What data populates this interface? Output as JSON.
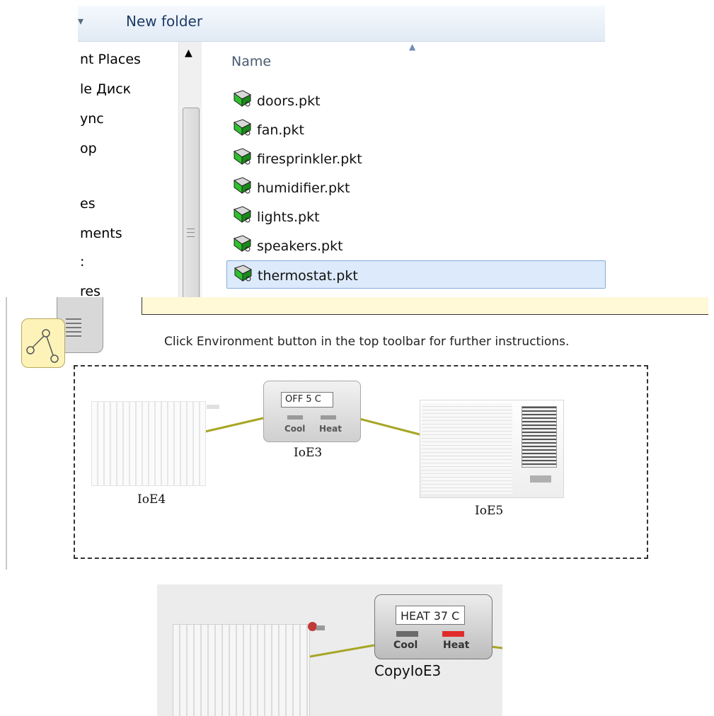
{
  "explorer": {
    "toolbar": {
      "new_folder_label": "New folder"
    },
    "nav_items": [
      {
        "label": "nt Places"
      },
      {
        "label": "le Диск"
      },
      {
        "label": "ync"
      },
      {
        "label": "op"
      },
      {
        "label": "es"
      },
      {
        "label": "ments"
      },
      {
        "label": ":"
      },
      {
        "label": "res"
      }
    ],
    "column_header": "Name",
    "files": [
      {
        "name": "doors.pkt",
        "selected": false
      },
      {
        "name": "fan.pkt",
        "selected": false
      },
      {
        "name": "firesprinkler.pkt",
        "selected": false
      },
      {
        "name": "humidifier.pkt",
        "selected": false
      },
      {
        "name": "lights.pkt",
        "selected": false
      },
      {
        "name": "speakers.pkt",
        "selected": false
      },
      {
        "name": "thermostat.pkt",
        "selected": true
      }
    ],
    "file_icon": "packet-tracer-file-icon"
  },
  "workspace": {
    "instruction": "Click Environment button in the top toolbar for further instructions.",
    "devices": {
      "radiator": {
        "label": "IoE4"
      },
      "thermostat": {
        "label": "IoE3",
        "display": "OFF  5 C",
        "cool_label": "Cool",
        "heat_label": "Heat",
        "cool_led": "#9a9a9a",
        "heat_led": "#9a9a9a"
      },
      "air_conditioner": {
        "label": "IoE5"
      }
    },
    "link_color": "#a7a624"
  },
  "zoom": {
    "thermostat": {
      "label": "CopyIoE3",
      "display": "HEAT  37 C",
      "cool_label": "Cool",
      "heat_label": "Heat",
      "cool_led": "#6a6a6a",
      "heat_led": "#e12a2a"
    },
    "radiator_indicator_color": "#c03a3a"
  }
}
